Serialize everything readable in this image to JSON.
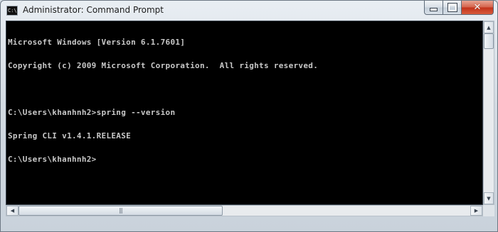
{
  "window": {
    "title": "Administrator: Command Prompt",
    "icon": "command-prompt-icon",
    "icon_text": "C:\\."
  },
  "controls": {
    "minimize_icon": "minimize-icon",
    "maximize_icon": "maximize-icon",
    "close_icon": "close-icon",
    "close_glyph": "✕"
  },
  "console": {
    "background": "#000000",
    "foreground": "#c8c8c8",
    "lines": [
      "Microsoft Windows [Version 6.1.7601]",
      "Copyright (c) 2009 Microsoft Corporation.  All rights reserved.",
      "",
      "C:\\Users\\khanhnh2>spring --version",
      "Spring CLI v1.4.1.RELEASE",
      "C:\\Users\\khanhnh2>"
    ]
  },
  "scrollbars": {
    "up_arrow": "▲",
    "down_arrow": "▼",
    "left_arrow": "◀",
    "right_arrow": "▶",
    "grip": "|||"
  }
}
